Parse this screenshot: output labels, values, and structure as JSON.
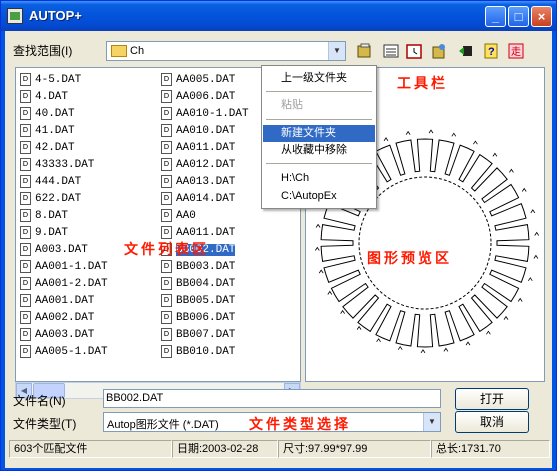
{
  "window": {
    "title": "AUTOP+"
  },
  "lookin": {
    "label": "查找范围(I)",
    "value": "Ch"
  },
  "toolbar": {
    "icons": [
      "folder-up-icon",
      "details-view-icon",
      "calendar-icon",
      "options-icon",
      "back-icon",
      "help-icon",
      "exit-icon"
    ],
    "annotation": "工具栏"
  },
  "files": {
    "column1": [
      "4-5.DAT",
      "4.DAT",
      "40.DAT",
      "41.DAT",
      "42.DAT",
      "43333.DAT",
      "444.DAT",
      "622.DAT",
      "8.DAT",
      "9.DAT",
      "A003.DAT",
      "AA001-1.DAT",
      "AA001-2.DAT",
      "AA001.DAT",
      "AA002.DAT",
      "AA003.DAT",
      "AA005-1.DAT"
    ],
    "column2": [
      "AA005.DAT",
      "AA006.DAT",
      "AA010-1.DAT",
      "AA010.DAT",
      "AA011.DAT",
      "AA012.DAT",
      "AA013.DAT",
      "AA014.DAT",
      "AA0",
      "AA011.DAT",
      "BB002.DAT",
      "BB003.DAT",
      "BB004.DAT",
      "BB005.DAT",
      "BB006.DAT",
      "BB007.DAT",
      "BB010.DAT"
    ],
    "selected": "BB002.DAT",
    "annotation": "文件列表区"
  },
  "context_menu": {
    "items": [
      {
        "label": "上一级文件夹",
        "state": "normal"
      },
      {
        "label": "粘贴",
        "state": "disabled"
      },
      {
        "label": "新建文件夹",
        "state": "highlight"
      },
      {
        "label": "从收藏中移除",
        "state": "normal"
      },
      {
        "label": "H:\\Ch",
        "state": "normal"
      },
      {
        "label": "C:\\AutopEx",
        "state": "normal"
      }
    ]
  },
  "preview": {
    "annotation": "图形预览区"
  },
  "filename": {
    "label": "文件名(N)",
    "value": "BB002.DAT"
  },
  "filetype": {
    "label": "文件类型(T)",
    "value": "Autop图形文件 (*.DAT)",
    "annotation": "文件类型选择"
  },
  "buttons": {
    "open": "打开",
    "cancel": "取消"
  },
  "status": {
    "count": "603个匹配文件",
    "date": "日期:2003-02-28",
    "size": "尺寸:97.99*97.99",
    "length": "总长:1731.70"
  },
  "colors": {
    "annotation": "#ff1a00",
    "selection": "#316ac5",
    "titlebar": "#0453dc"
  }
}
